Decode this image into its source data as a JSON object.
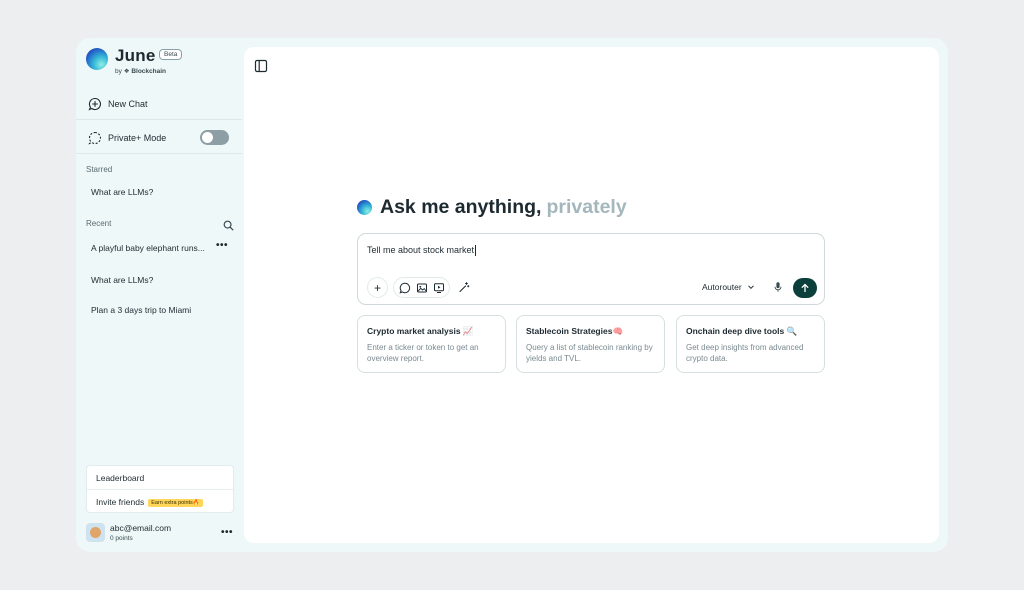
{
  "brand": {
    "name": "June",
    "badge": "Beta",
    "by": "by",
    "company": "Blockchain"
  },
  "sidebar": {
    "new_chat": "New Chat",
    "private_mode": "Private+ Mode",
    "starred_label": "Starred",
    "starred": [
      "What are LLMs?"
    ],
    "recent_label": "Recent",
    "recent": [
      "A playful baby elephant runs...",
      "What are LLMs?",
      "Plan a 3 days trip to Miami"
    ],
    "more": "•••",
    "leaderboard": "Leaderboard",
    "invite": "Invite friends",
    "earn_badge": "Earn extra points🔥",
    "user_email": "abc@email.com",
    "user_points": "0 points"
  },
  "main": {
    "hero_title": "Ask me anything,",
    "hero_accent": "privately",
    "input_value": "Tell me about stock market",
    "plus": "+",
    "model_select": "Autorouter",
    "cards": [
      {
        "title": "Crypto market analysis",
        "emoji": "📈",
        "desc": "Enter a ticker or token to get an overview report."
      },
      {
        "title": "Stablecoin Strategies",
        "emoji": "🧠",
        "desc": "Query a list of stablecoin ranking by yields and TVL."
      },
      {
        "title": "Onchain deep dive tools",
        "emoji": "🔍",
        "desc": "Get deep insights from advanced crypto data."
      }
    ]
  },
  "colors": {
    "accent_dark": "#0b3f3c",
    "muted_accent": "#a3b7bd",
    "sidebar_bg": "#eef8f9",
    "badge_yellow": "#ffd65a"
  }
}
